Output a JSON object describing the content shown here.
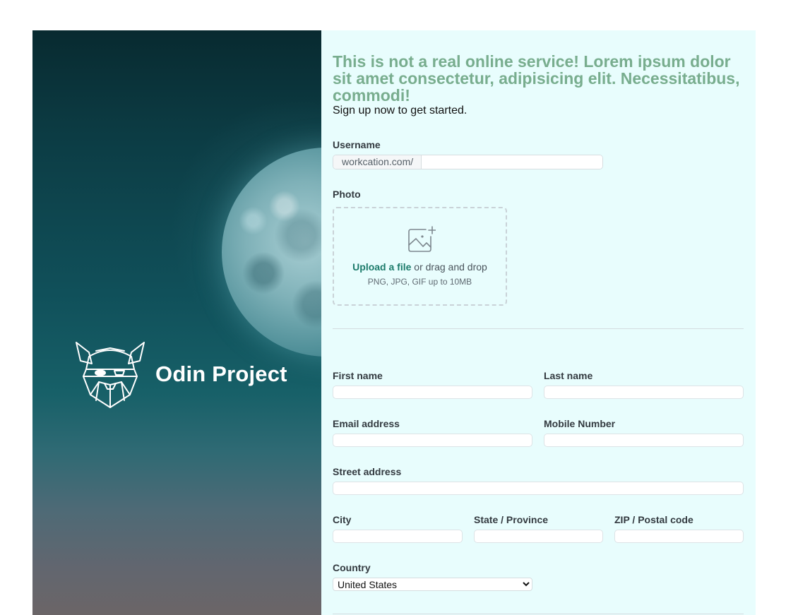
{
  "brand": {
    "name": "Odin Project"
  },
  "form": {
    "headline": "This is not a real online service! Lorem ipsum dolor sit amet consectetur, adipisicing elit. Necessitatibus, commodi!",
    "subline": "Sign up now to get started.",
    "username": {
      "label": "Username",
      "prefix": "workcation.com/",
      "value": ""
    },
    "photo": {
      "label": "Photo",
      "upload_link": "Upload a file",
      "upload_text": " or drag and drop",
      "hint": "PNG, JPG, GIF up to 10MB"
    },
    "first_name": {
      "label": "First name",
      "value": ""
    },
    "last_name": {
      "label": "Last name",
      "value": ""
    },
    "email": {
      "label": "Email address",
      "value": ""
    },
    "mobile": {
      "label": "Mobile Number",
      "value": ""
    },
    "street": {
      "label": "Street address",
      "value": ""
    },
    "city": {
      "label": "City",
      "value": ""
    },
    "state": {
      "label": "State / Province",
      "value": ""
    },
    "zip": {
      "label": "ZIP / Postal code",
      "value": ""
    },
    "country": {
      "label": "Country",
      "selected": "United States"
    }
  },
  "colors": {
    "headline": "#78ad8e",
    "panel_bg": "#e8fdfd",
    "link": "#1c7b6b"
  },
  "icons": [
    "odin-helmet-logo-icon",
    "image-add-icon",
    "chevron-down-icon"
  ]
}
